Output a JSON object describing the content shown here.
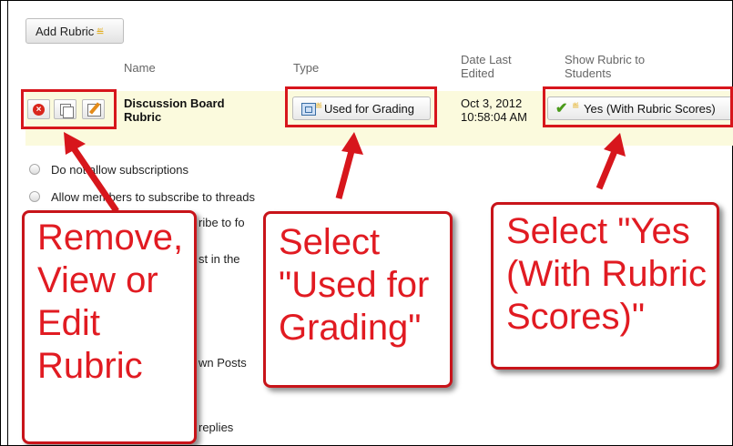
{
  "toolbar": {
    "add_rubric_label": "Add Rubric"
  },
  "columns": {
    "name": "Name",
    "type": "Type",
    "date_last_edited": "Date Last Edited",
    "show_to_students": "Show Rubric to Students"
  },
  "row": {
    "name": "Discussion Board Rubric",
    "type": "Used for Grading",
    "date": "Oct 3, 2012 10:58:04 AM",
    "show": "Yes (With Rubric Scores)"
  },
  "options": {
    "no_subscriptions": "Do not allow subscriptions",
    "subscribe_threads": "Allow members to subscribe to threads",
    "frag_subscribe_forum": "ribe to fo",
    "frag_post_in": "st in the",
    "frag_own_posts": "wn Posts",
    "frag_replies": "replies"
  },
  "callouts": {
    "remove_view_edit": "Remove, View or Edit Rubric",
    "select_used_for_grading": "Select \"Used for Grading\"",
    "select_yes": "Select \"Yes (With Rubric Scores)\""
  },
  "colors": {
    "annotation_red": "#d7161c",
    "row_highlight": "#fbfadd"
  }
}
